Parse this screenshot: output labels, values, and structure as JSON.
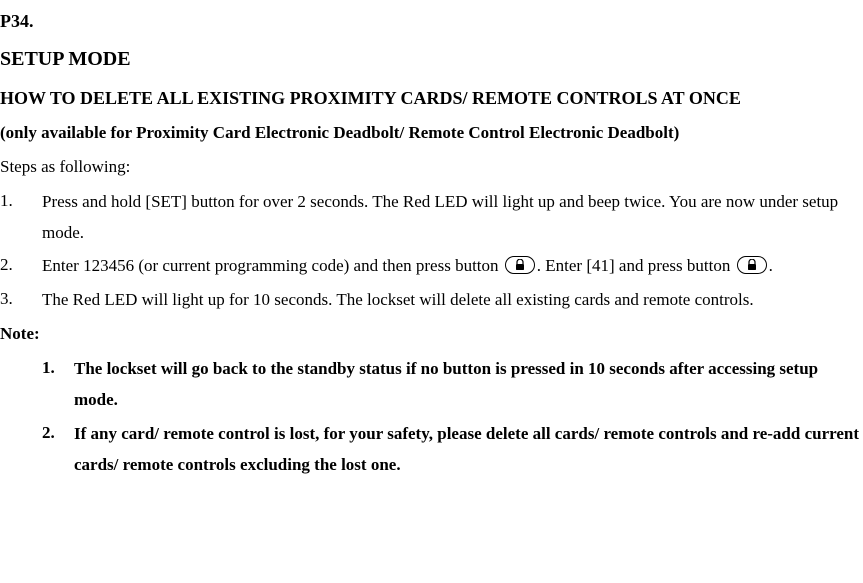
{
  "page_number": "P34.",
  "title": "SETUP MODE",
  "how_to": "HOW TO DELETE ALL EXISTING PROXIMITY CARDS/ REMOTE CONTROLS AT ONCE",
  "only_available": "(only available for Proximity Card Electronic Deadbolt/ Remote Control Electronic Deadbolt)",
  "steps_intro": "Steps as following:",
  "steps": [
    {
      "num": "1.",
      "text": "Press and hold [SET] button for over 2 seconds. The Red LED will light up and beep twice. You are now under setup mode."
    },
    {
      "num": "2.",
      "text_before": "Enter 123456 (or current programming code) and then press button ",
      "text_mid": ". Enter [41] and press button ",
      "text_after": "."
    },
    {
      "num": "3.",
      "text": "The Red LED will light up for 10 seconds. The lockset will delete all existing cards and remote controls."
    }
  ],
  "note_label": "Note:",
  "notes": [
    {
      "num": "1.",
      "text": "The lockset will go back to the standby status if no button is pressed in 10 seconds after accessing setup mode."
    },
    {
      "num": "2.",
      "text": "If any card/ remote control is lost, for your safety, please delete all cards/ remote controls and re-add current cards/ remote controls excluding the lost one."
    }
  ]
}
